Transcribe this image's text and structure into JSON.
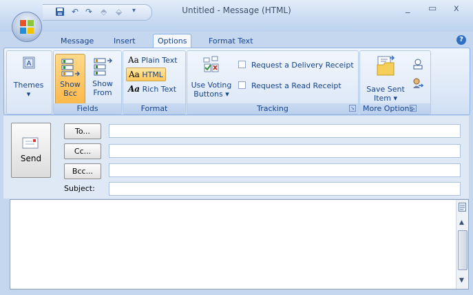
{
  "window": {
    "title": "Untitled - Message (HTML)",
    "minimize": "_",
    "maximize": "▭",
    "close": "x"
  },
  "qat": {
    "save_icon": "save-icon",
    "undo_icon": "undo-icon",
    "redo_icon": "redo-icon",
    "prev_icon": "up-arrow-icon",
    "next_icon": "down-arrow-icon",
    "customize_icon": "customize-qat-icon"
  },
  "tabs": [
    "Message",
    "Insert",
    "Options",
    "Format Text"
  ],
  "active_tab": "Options",
  "help": "?",
  "ribbon": {
    "themes": {
      "label": "Themes",
      "arrow": "▾",
      "icon": "themes-icon"
    },
    "fields": {
      "group_label": "Fields",
      "show_bcc": {
        "line1": "Show",
        "line2": "Bcc"
      },
      "show_from": {
        "line1": "Show",
        "line2": "From"
      }
    },
    "format": {
      "group_label": "Format",
      "plain_text": "Plain Text",
      "html": "HTML",
      "rich_text": "Rich Text",
      "plain_prefix": "Aa",
      "html_prefix": "Aa",
      "rich_prefix": "Aa"
    },
    "tracking": {
      "group_label": "Tracking",
      "use_voting_line1": "Use Voting",
      "use_voting_line2": "Buttons",
      "delivery_receipt": "Request a Delivery Receipt",
      "read_receipt": "Request a Read Receipt"
    },
    "more_options": {
      "group_label": "More Options",
      "save_sent_line1": "Save Sent",
      "save_sent_line2": "Item"
    }
  },
  "compose": {
    "send": "Send",
    "to": "To...",
    "cc": "Cc...",
    "bcc": "Bcc...",
    "subject_label": "Subject:",
    "to_value": "",
    "cc_value": "",
    "bcc_value": "",
    "subject_value": ""
  },
  "colors": {
    "accent": "#15428b",
    "active_button": "#ffc85a",
    "ribbon_bg": "#dbe7f7"
  }
}
